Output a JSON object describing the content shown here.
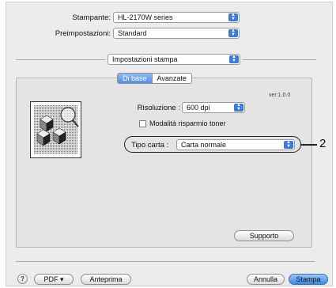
{
  "printer": {
    "label": "Stampante:",
    "value": "HL-2170W series"
  },
  "presets": {
    "label": "Preimpostazioni:",
    "value": "Standard"
  },
  "section": {
    "value": "Impostazioni stampa"
  },
  "tabs": [
    {
      "label": "Di base",
      "active": true
    },
    {
      "label": "Avanzate",
      "active": false
    }
  ],
  "version": "ver:1.0.0",
  "resolution": {
    "label": "Risoluzione :",
    "value": "600 dpi"
  },
  "toner_saving": {
    "label": "Modalità risparmio toner",
    "checked": false
  },
  "paper_type": {
    "label": "Tipo carta :",
    "value": "Carta normale"
  },
  "callout": "2",
  "support_button": "Supporto",
  "footer": {
    "help": "?",
    "pdf": "PDF ▾",
    "preview": "Anteprima",
    "cancel": "Annulla",
    "print": "Stampa"
  },
  "colors": {
    "accent": "#3c79d8",
    "dialog_bg": "#ececec",
    "panel_bg": "#e4e4e4"
  },
  "icons": {
    "popup": "popup-arrows-icon",
    "preview": "cube-magnifier-icon"
  }
}
